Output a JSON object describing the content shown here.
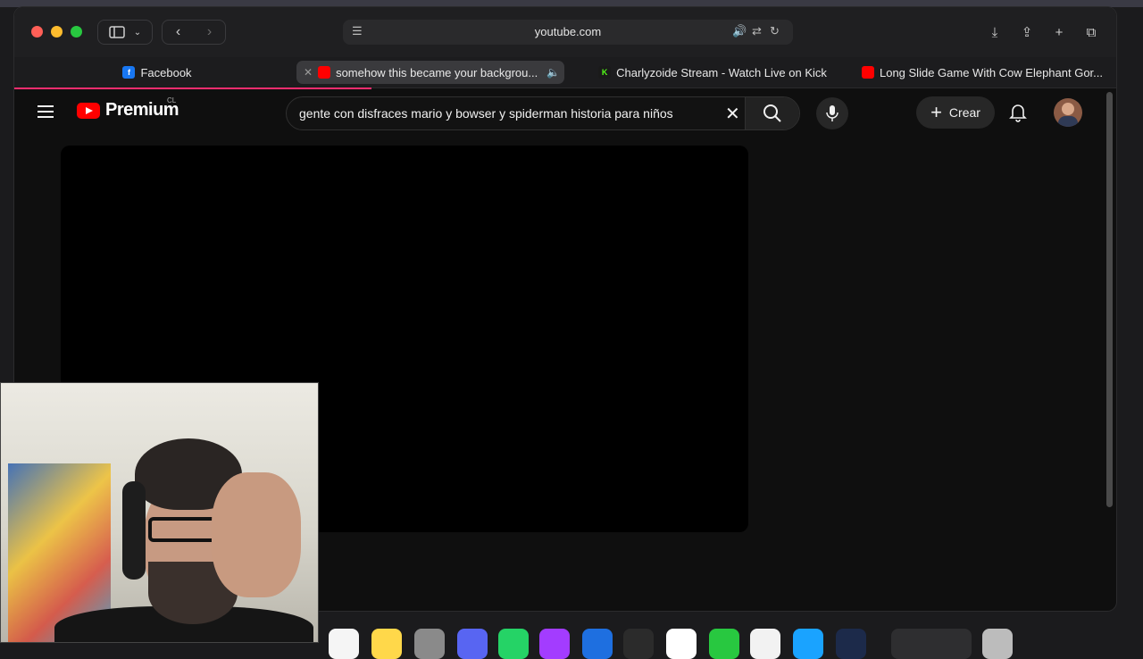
{
  "browser": {
    "address": {
      "url": "youtube.com"
    },
    "tabs": [
      {
        "label": "Facebook",
        "favicon": "facebook-icon"
      },
      {
        "label": "somehow this became your backgrou...",
        "favicon": "youtube-icon",
        "active": true,
        "audio": true
      },
      {
        "label": "Charlyzoide Stream - Watch Live on Kick",
        "favicon": "kick-icon"
      },
      {
        "label": "Long Slide Game With Cow Elephant Gor...",
        "favicon": "youtube-icon"
      }
    ]
  },
  "youtube": {
    "logo_text": "Premium",
    "country_code": "CL",
    "search": {
      "query": "gente con disfraces mario y bowser y spiderman historia para niños"
    },
    "create_label": "Crear"
  },
  "colors": {
    "youtube_red": "#ff0000",
    "load_bar": "#ff2d6f",
    "background": "#0f0f0f"
  }
}
